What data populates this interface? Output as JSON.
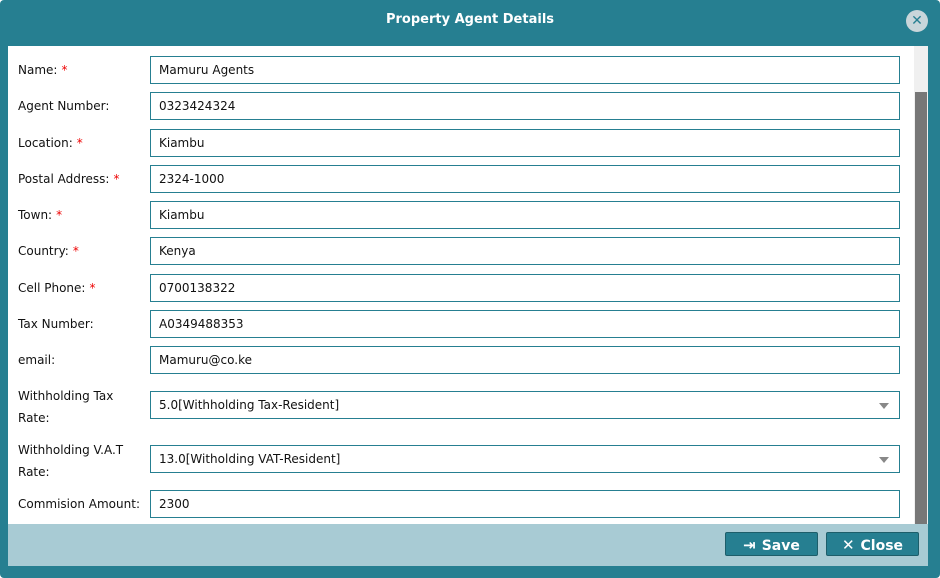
{
  "dialog": {
    "title": "Property Agent Details",
    "close_glyph": "✕"
  },
  "required_mark": "*",
  "fields": [
    {
      "label": "Name:",
      "required": true,
      "value": "Mamuru Agents"
    },
    {
      "label": "Agent Number:",
      "required": false,
      "value": "0323424324"
    },
    {
      "label": "Location:",
      "required": true,
      "value": "Kiambu"
    },
    {
      "label": "Postal Address:",
      "required": true,
      "value": "2324-1000"
    },
    {
      "label": "Town:",
      "required": true,
      "value": "Kiambu"
    },
    {
      "label": "Country:",
      "required": true,
      "value": "Kenya"
    },
    {
      "label": "Cell Phone:",
      "required": true,
      "value": "0700138322"
    },
    {
      "label": "Tax Number:",
      "required": false,
      "value": "A0349488353"
    },
    {
      "label": "email:",
      "required": false,
      "value": "Mamuru@co.ke"
    },
    {
      "label_line1": "Withholding Tax",
      "label_line2": "Rate:",
      "value": "5.0[Withholding Tax-Resident]"
    },
    {
      "label_line1": "Withholding V.A.T",
      "label_line2": "Rate:",
      "value": "13.0[Witholding VAT-Resident]"
    },
    {
      "label": "Commision Amount:",
      "required": false,
      "value": "2300"
    }
  ],
  "footer": {
    "save_label": "Save",
    "save_icon": "sign-in-icon",
    "close_label": "Close",
    "close_icon": "close-icon"
  },
  "colors": {
    "primary": "#267f91",
    "footer": "#a8cbd4",
    "required": "#e00000"
  }
}
